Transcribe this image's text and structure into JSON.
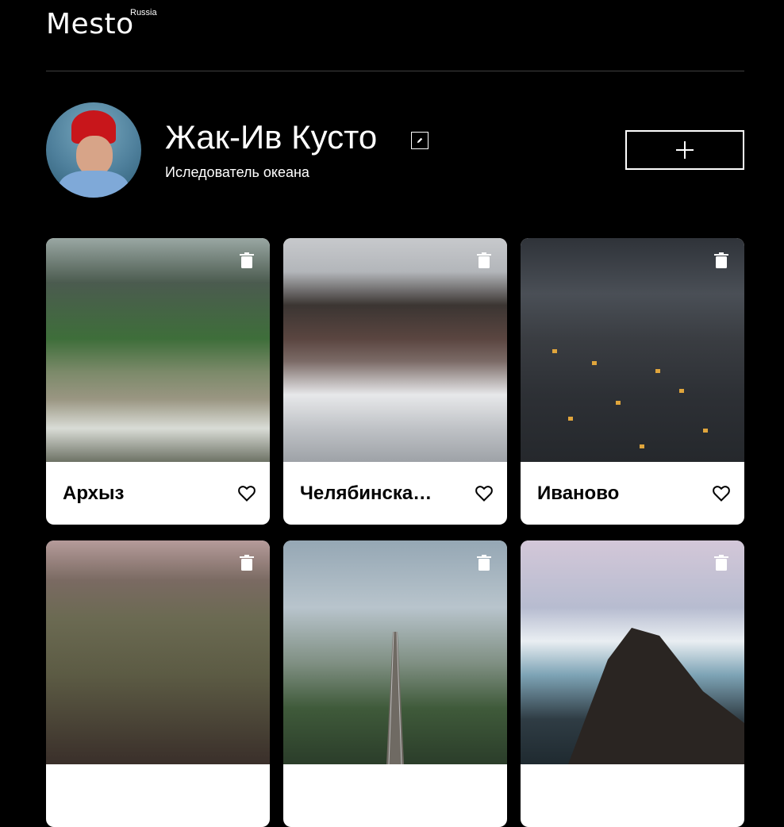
{
  "header": {
    "logo": "Mesto",
    "logo_sup": "Russia"
  },
  "profile": {
    "name": "Жак-Ив Кусто",
    "about": "Иследователь океана",
    "edit_icon": "pencil-icon",
    "add_icon": "plus-icon"
  },
  "cards": [
    {
      "title": "Архыз"
    },
    {
      "title": "Челябинская область"
    },
    {
      "title": "Иваново"
    },
    {
      "title": ""
    },
    {
      "title": ""
    },
    {
      "title": ""
    }
  ],
  "colors": {
    "background": "#000000",
    "card": "#ffffff",
    "divider": "#3f3f3f"
  }
}
